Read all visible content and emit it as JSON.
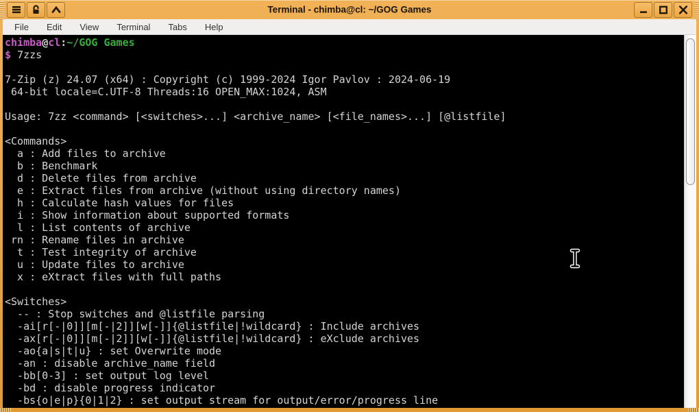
{
  "window": {
    "title": "Terminal - chimba@cl: ~/GOG Games",
    "titlebar_icons_left": [
      "window-menu-icon",
      "unlock-icon",
      "shade-up-icon"
    ],
    "titlebar_icons_right": [
      "minimize-icon",
      "maximize-icon",
      "close-icon"
    ]
  },
  "menubar": {
    "items": [
      "File",
      "Edit",
      "View",
      "Terminal",
      "Tabs",
      "Help"
    ]
  },
  "colors": {
    "titlebar": "#e8a440",
    "terminal_bg": "#000000",
    "fg": "#d4d4d4",
    "magenta": "#cb5bcb",
    "green": "#3cae3c"
  },
  "terminal": {
    "lines": [
      {
        "segments": [
          {
            "text": "chimba",
            "color": "magenta",
            "bold": true
          },
          {
            "text": "@",
            "color": "fg",
            "bold": true
          },
          {
            "text": "cl",
            "color": "magenta",
            "bold": true
          },
          {
            "text": ":",
            "color": "fg",
            "bold": true
          },
          {
            "text": "~/GOG Games",
            "color": "green",
            "bold": true
          }
        ]
      },
      {
        "segments": [
          {
            "text": "$",
            "color": "magenta",
            "bold": true
          },
          {
            "text": " 7zzs",
            "color": "fg",
            "bold": false
          }
        ]
      },
      "",
      "7-Zip (z) 24.07 (x64) : Copyright (c) 1999-2024 Igor Pavlov : 2024-06-19",
      " 64-bit locale=C.UTF-8 Threads:16 OPEN_MAX:1024, ASM",
      "",
      "Usage: 7zz <command> [<switches>...] <archive_name> [<file_names>...] [@listfile]",
      "",
      "<Commands>",
      "  a : Add files to archive",
      "  b : Benchmark",
      "  d : Delete files from archive",
      "  e : Extract files from archive (without using directory names)",
      "  h : Calculate hash values for files",
      "  i : Show information about supported formats",
      "  l : List contents of archive",
      " rn : Rename files in archive",
      "  t : Test integrity of archive",
      "  u : Update files to archive",
      "  x : eXtract files with full paths",
      "",
      "<Switches>",
      "  -- : Stop switches and @listfile parsing",
      "  -ai[r[-|0]][m[-|2]][w[-]]{@listfile|!wildcard} : Include archives",
      "  -ax[r[-|0]][m[-|2]][w[-]]{@listfile|!wildcard} : eXclude archives",
      "  -ao{a|s|t|u} : set Overwrite mode",
      "  -an : disable archive_name field",
      "  -bb[0-3] : set output log level",
      "  -bd : disable progress indicator",
      "  -bs{o|e|p}{0|1|2} : set output stream for output/error/progress line"
    ]
  }
}
